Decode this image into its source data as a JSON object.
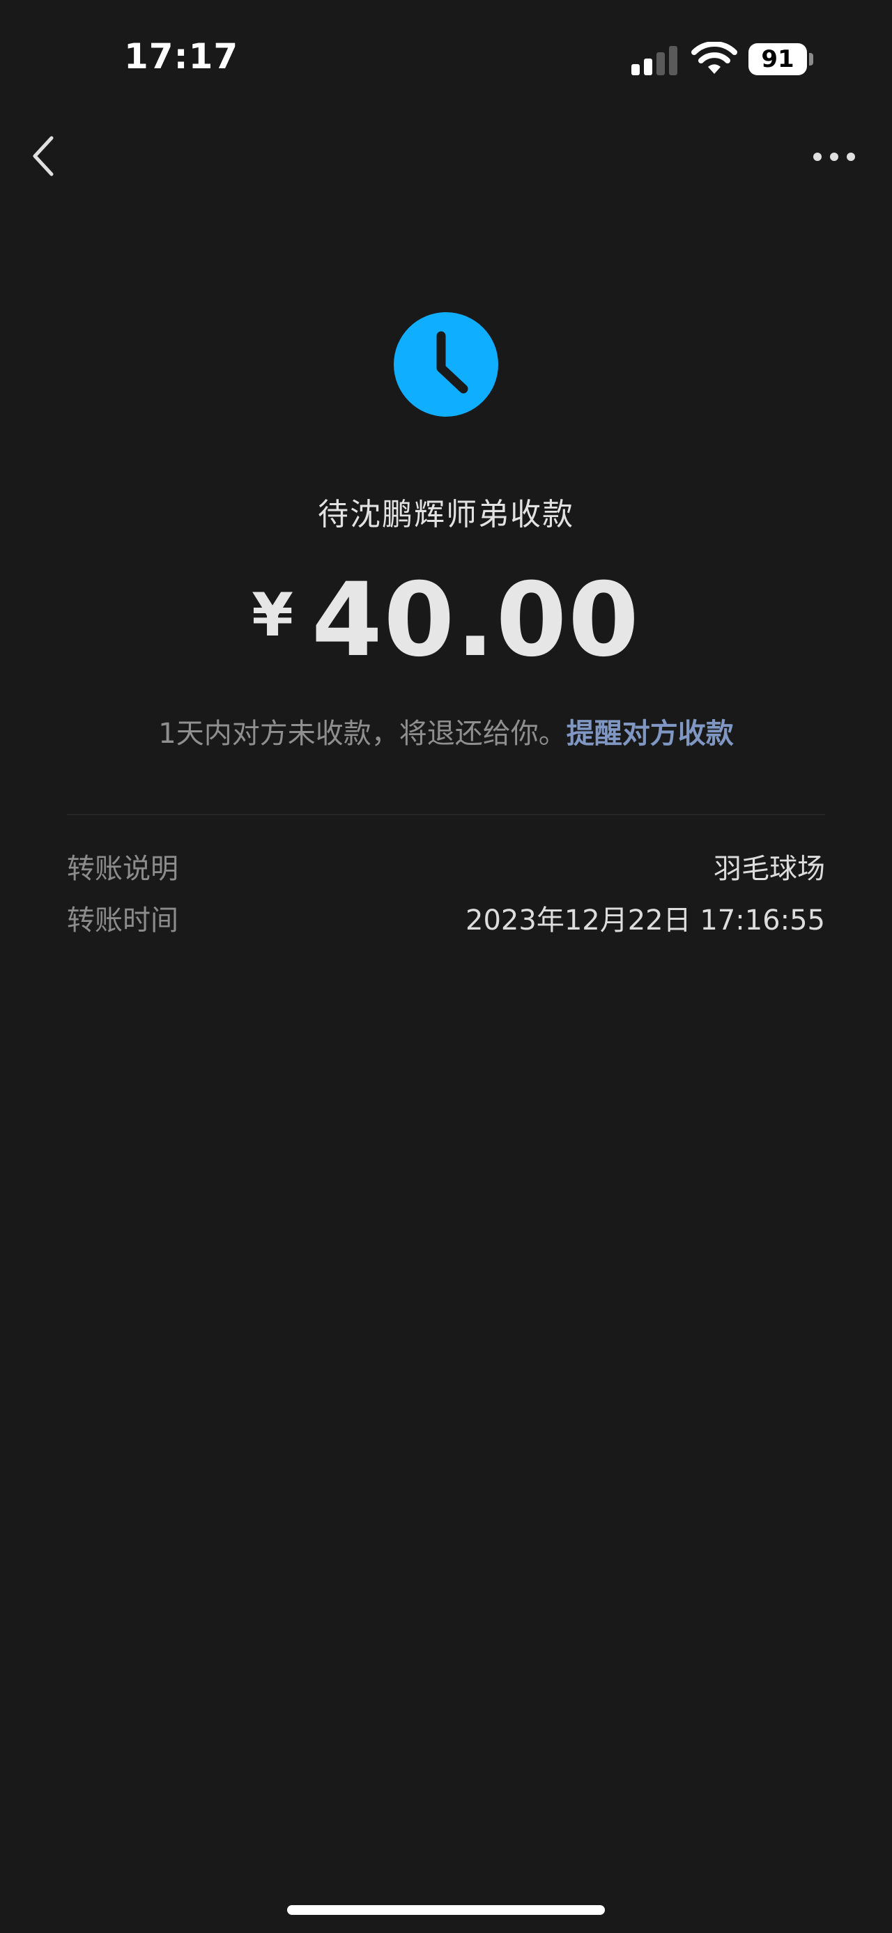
{
  "status_bar": {
    "time": "17:17",
    "battery": "91"
  },
  "nav": {
    "back_icon": "chevron-left-icon",
    "more_icon": "ellipsis-icon"
  },
  "transfer": {
    "status_icon": "clock-icon",
    "status_color": "#10AEFF",
    "status_title": "待沈鹏辉师弟收款",
    "currency": "¥",
    "amount": "40.00",
    "notice": "1天内对方未收款，将退还给你。",
    "remind_link": "提醒对方收款"
  },
  "details": [
    {
      "label": "转账说明",
      "value": "羽毛球场"
    },
    {
      "label": "转账时间",
      "value": "2023年12月22日 17:16:55"
    }
  ]
}
